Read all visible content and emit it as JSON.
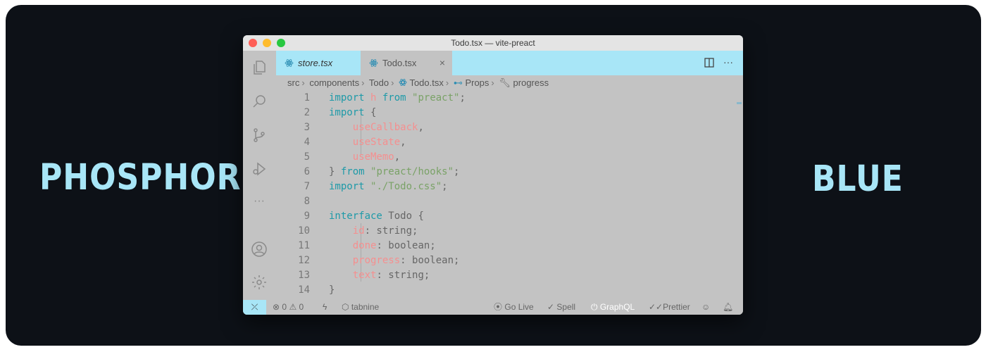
{
  "side_words": {
    "left": "PHOSPHORIC",
    "right": "BLUE"
  },
  "window": {
    "title": "Todo.tsx — vite-preact"
  },
  "tabs": [
    {
      "label": "store.tsx",
      "icon": "react-icon",
      "active": false
    },
    {
      "label": "Todo.tsx",
      "icon": "react-icon",
      "active": true,
      "close": "×"
    }
  ],
  "breadcrumb": [
    "src",
    "components",
    "Todo",
    "Todo.tsx",
    "Props",
    "progress"
  ],
  "code_lines": [
    {
      "n": "1",
      "tokens": [
        [
          "kw",
          "import "
        ],
        [
          "var",
          "h "
        ],
        [
          "kw",
          "from "
        ],
        [
          "str",
          "\"preact\""
        ],
        [
          "plain",
          ";"
        ]
      ]
    },
    {
      "n": "2",
      "tokens": [
        [
          "kw",
          "import "
        ],
        [
          "plain",
          "{"
        ]
      ]
    },
    {
      "n": "3",
      "tokens": [
        [
          "plain",
          "    "
        ],
        [
          "var",
          "useCallback"
        ],
        [
          "plain",
          ","
        ]
      ]
    },
    {
      "n": "4",
      "tokens": [
        [
          "plain",
          "    "
        ],
        [
          "var",
          "useState"
        ],
        [
          "plain",
          ","
        ]
      ]
    },
    {
      "n": "5",
      "tokens": [
        [
          "plain",
          "    "
        ],
        [
          "var",
          "useMemo"
        ],
        [
          "plain",
          ","
        ]
      ]
    },
    {
      "n": "6",
      "tokens": [
        [
          "plain",
          "} "
        ],
        [
          "kw",
          "from "
        ],
        [
          "str",
          "\"preact/hooks\""
        ],
        [
          "plain",
          ";"
        ]
      ]
    },
    {
      "n": "7",
      "tokens": [
        [
          "kw",
          "import "
        ],
        [
          "str",
          "\"./Todo.css\""
        ],
        [
          "plain",
          ";"
        ]
      ]
    },
    {
      "n": "8",
      "tokens": []
    },
    {
      "n": "9",
      "tokens": [
        [
          "kw",
          "interface "
        ],
        [
          "plain",
          "Todo {"
        ]
      ]
    },
    {
      "n": "10",
      "tokens": [
        [
          "plain",
          "    "
        ],
        [
          "var",
          "id"
        ],
        [
          "plain",
          ": string;"
        ]
      ]
    },
    {
      "n": "11",
      "tokens": [
        [
          "plain",
          "    "
        ],
        [
          "var",
          "done"
        ],
        [
          "plain",
          ": boolean;"
        ]
      ]
    },
    {
      "n": "12",
      "tokens": [
        [
          "plain",
          "    "
        ],
        [
          "var",
          "progress"
        ],
        [
          "plain",
          ": boolean;"
        ]
      ]
    },
    {
      "n": "13",
      "tokens": [
        [
          "plain",
          "    "
        ],
        [
          "var",
          "text"
        ],
        [
          "plain",
          ": string;"
        ]
      ]
    },
    {
      "n": "14",
      "tokens": [
        [
          "plain",
          "}"
        ]
      ]
    }
  ],
  "status": {
    "errors": "0",
    "warnings": "0",
    "tabnine": "tabnine",
    "go_live": "Go Live",
    "spell": "Spell",
    "graphql": "GraphQL",
    "prettier": "Prettier"
  },
  "colors": {
    "accent": "#a8e6f7",
    "keyword": "#1e9aa8",
    "string": "#7aa267",
    "variable": "#f58f8f"
  }
}
